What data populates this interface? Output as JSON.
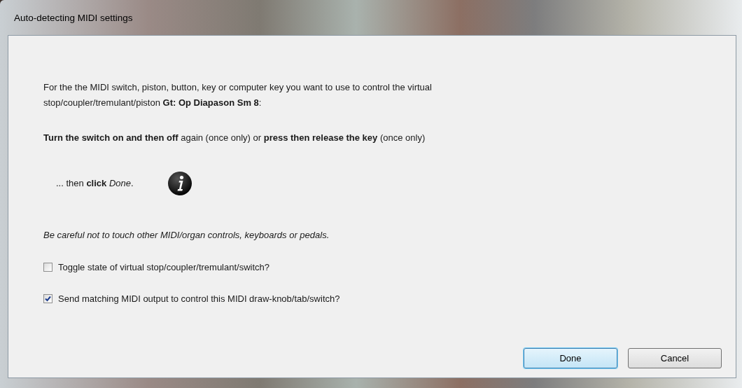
{
  "window": {
    "title": "Auto-detecting MIDI settings"
  },
  "paragraphs": [
    {
      "kind": "normal",
      "text": "For the the MIDI switch, piston, button, key or computer key you want to use to control the virtual stop/coupler/tremulant/piston **Gt: Op Diapason Sm 8**:"
    },
    {
      "kind": "normal",
      "text": "**Turn the switch on and then off** again (once only) or **press then release the key** (once only)"
    },
    {
      "kind": "action",
      "text": "... then **click** *Done*."
    },
    {
      "kind": "warning",
      "text": "Be careful not to touch other MIDI/organ controls, keyboards or pedals."
    }
  ],
  "checkboxes": [
    {
      "label": "Toggle state of virtual stop/coupler/tremulant/switch?",
      "checked": false
    },
    {
      "label": "Send matching MIDI output to control this MIDI draw-knob/tab/switch?",
      "checked": true
    }
  ],
  "buttons": [
    {
      "label": "Done",
      "default": true
    },
    {
      "label": "Cancel",
      "default": false
    }
  ]
}
